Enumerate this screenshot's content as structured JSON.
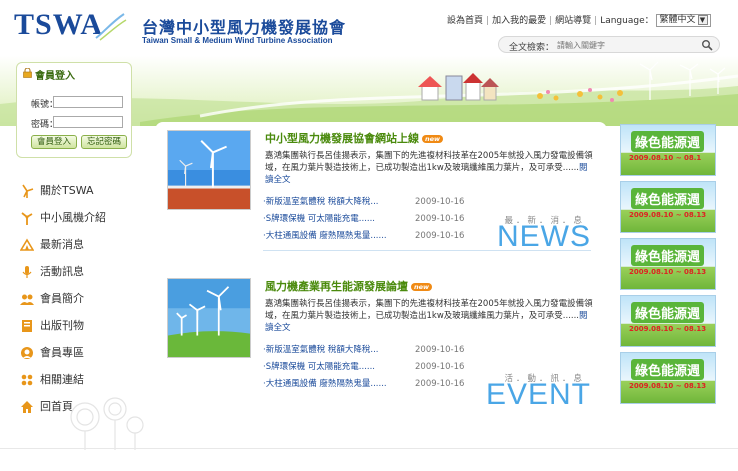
{
  "header": {
    "logo_mark": "TSWA",
    "logo_zh": "台灣中小型風力機發展協會",
    "logo_en": "Taiwan Small & Medium Wind Turbine Association",
    "topnav": {
      "home": "設為首頁",
      "favorite": "加入我的最愛",
      "sitemap": "網站導覽",
      "language_label": "Language：",
      "language_value": "繁體中文"
    },
    "search": {
      "label": "全文檢索：",
      "placeholder": "請輸入關鍵字"
    }
  },
  "login": {
    "title": "會員登入",
    "account_label": "帳號：",
    "password_label": "密碼：",
    "login_button": "會員登入",
    "forgot_button": "忘記密碼"
  },
  "sidenav": [
    {
      "label": "關於TSWA",
      "icon": "windmill-icon"
    },
    {
      "label": "中小風機介紹",
      "icon": "turbine-icon"
    },
    {
      "label": "最新消息",
      "icon": "news-icon"
    },
    {
      "label": "活動訊息",
      "icon": "microphone-icon"
    },
    {
      "label": "會員簡介",
      "icon": "members-icon"
    },
    {
      "label": "出版刊物",
      "icon": "book-icon"
    },
    {
      "label": "會員專區",
      "icon": "member-zone-icon"
    },
    {
      "label": "相關連結",
      "icon": "link-icon"
    },
    {
      "label": "回首頁",
      "icon": "home-icon"
    }
  ],
  "news": {
    "title": "中小型風力機發展協會網站上線",
    "badge": "new",
    "desc": "嘉鴻集團執行長呂佳揚表示，集團下的先進複材科技革在2005年就投入風力發電設備領域，在風力葉片製造技術上，已成功製造出1kw及玻璃纖維風力葉片，及可承受......",
    "more": "閱讀全文",
    "items": [
      {
        "title": "新版溫室氣體稅 稅額大降稅...",
        "date": "2009-10-16"
      },
      {
        "title": "S牌環保機 可太陽能充電......",
        "date": "2009-10-16"
      },
      {
        "title": "大柱通風設備 廢熱隔熱鬼量......",
        "date": "2009-10-16"
      }
    ],
    "section_dots": "最．新．消．息",
    "section_word": "NEWS"
  },
  "event": {
    "title": "風力機產業再生能源發展論壇",
    "badge": "new",
    "desc": "嘉鴻集團執行長呂佳揚表示，集團下的先進複材科技革在2005年就投入風力發電設備領域，在風力葉片製造技術上，已成功製造出1kw及玻璃纖維風力葉片，及可承受......",
    "more": "閱讀全文",
    "items": [
      {
        "title": "新版溫室氣體稅 稅額大降稅...",
        "date": "2009-10-16"
      },
      {
        "title": "S牌環保機 可太陽能充電......",
        "date": "2009-10-16"
      },
      {
        "title": "大柱通風設備 廢熱隔熱鬼量......",
        "date": "2009-10-16"
      }
    ],
    "section_dots": "活．動．訊．息",
    "section_word": "EVENT"
  },
  "ads": [
    {
      "title": "綠色能源週",
      "date": "2009.08.10 ~ 08.1"
    },
    {
      "title": "綠色能源週",
      "date": "2009.08.10 ~ 08.13"
    },
    {
      "title": "綠色能源週",
      "date": "2009.08.10 ~ 08.13"
    },
    {
      "title": "綠色能源週",
      "date": "2009.08.10 ~ 08.13"
    },
    {
      "title": "綠色能源週",
      "date": "2009.08.10 ~ 08.13"
    }
  ],
  "colors": {
    "brand_blue": "#1a4a9a",
    "title_green": "#4a8a0c",
    "accent_orange": "#f08a14",
    "news_blue": "#4aa6e6"
  }
}
